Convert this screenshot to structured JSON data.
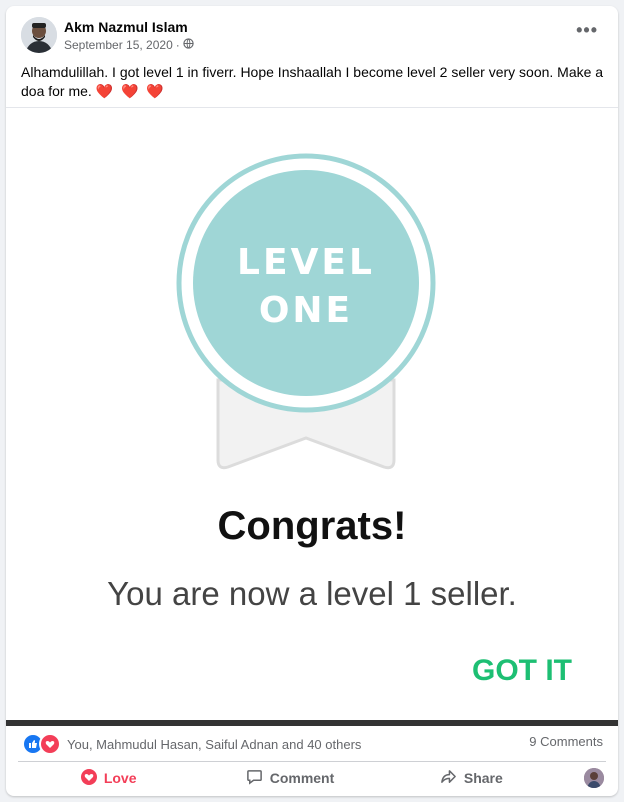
{
  "post": {
    "author": "Akm Nazmul Islam",
    "date": "September 15, 2020",
    "date_separator": "·",
    "privacy_icon": "globe-icon",
    "more_label": "•••",
    "text": "Alhamdulillah. I got level 1 in fiverr. Hope Inshaallah I become level 2 seller very soon. Make a doa for me.",
    "hearts": "❤️ ❤️ ❤️"
  },
  "image": {
    "badge_line1": "LEVEL",
    "badge_line2": "ONE",
    "headline": "Congrats!",
    "subtitle": "You are now a level 1 seller.",
    "button": "GOT IT",
    "colors": {
      "badge": "#9fd6d6",
      "button": "#1dbf73"
    }
  },
  "reactions": {
    "icons": [
      "like-icon",
      "love-icon"
    ],
    "summary": "You, Mahmudul Hasan, Saiful Adnan and 40 others",
    "comments": "9 Comments"
  },
  "actions": {
    "love": "Love",
    "comment": "Comment",
    "share": "Share"
  }
}
